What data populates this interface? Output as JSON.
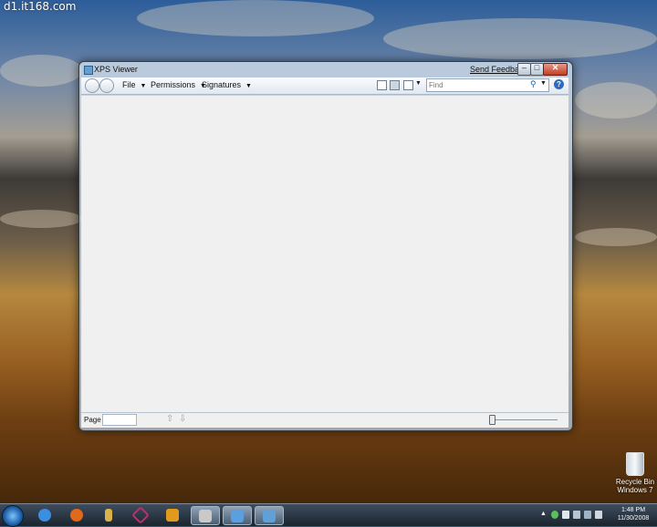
{
  "watermark": "d1.it168.com",
  "window": {
    "title": "XPS Viewer",
    "send_feedback": "Send Feedback",
    "caption": {
      "minimize": "–",
      "maximize": "□",
      "close": "✕"
    }
  },
  "toolbar": {
    "menus": [
      {
        "label": "File"
      },
      {
        "label": "Permissions"
      },
      {
        "label": "Signatures"
      }
    ],
    "find_placeholder": "Find",
    "help": "?"
  },
  "statusbar": {
    "page_label": "Page",
    "page_value": ""
  },
  "desktop": {
    "recycle_bin_label": "Recycle Bin",
    "os_label": "Windows 7"
  },
  "taskbar": {
    "time": "1:48 PM",
    "date": "11/30/2008",
    "buttons": [
      {
        "icon": "internet-explorer-icon",
        "color": "#3a8fe0"
      },
      {
        "icon": "firefox-icon",
        "color": "#e06a1a"
      },
      {
        "icon": "file-cabinet-icon",
        "color": "#d9b24a"
      },
      {
        "icon": "crossed-lines-icon",
        "color": "#c0306a"
      },
      {
        "icon": "media-player-icon",
        "color": "#e09a1c"
      },
      {
        "icon": "film-strip-icon",
        "color": "#c9c9c9"
      },
      {
        "icon": "camera-icon",
        "color": "#5aa0e0"
      },
      {
        "icon": "xps-viewer-icon",
        "color": "#5fa1d6"
      }
    ]
  },
  "colors": {
    "accent": "#2d6bc0",
    "close_button": "#c43c24"
  }
}
